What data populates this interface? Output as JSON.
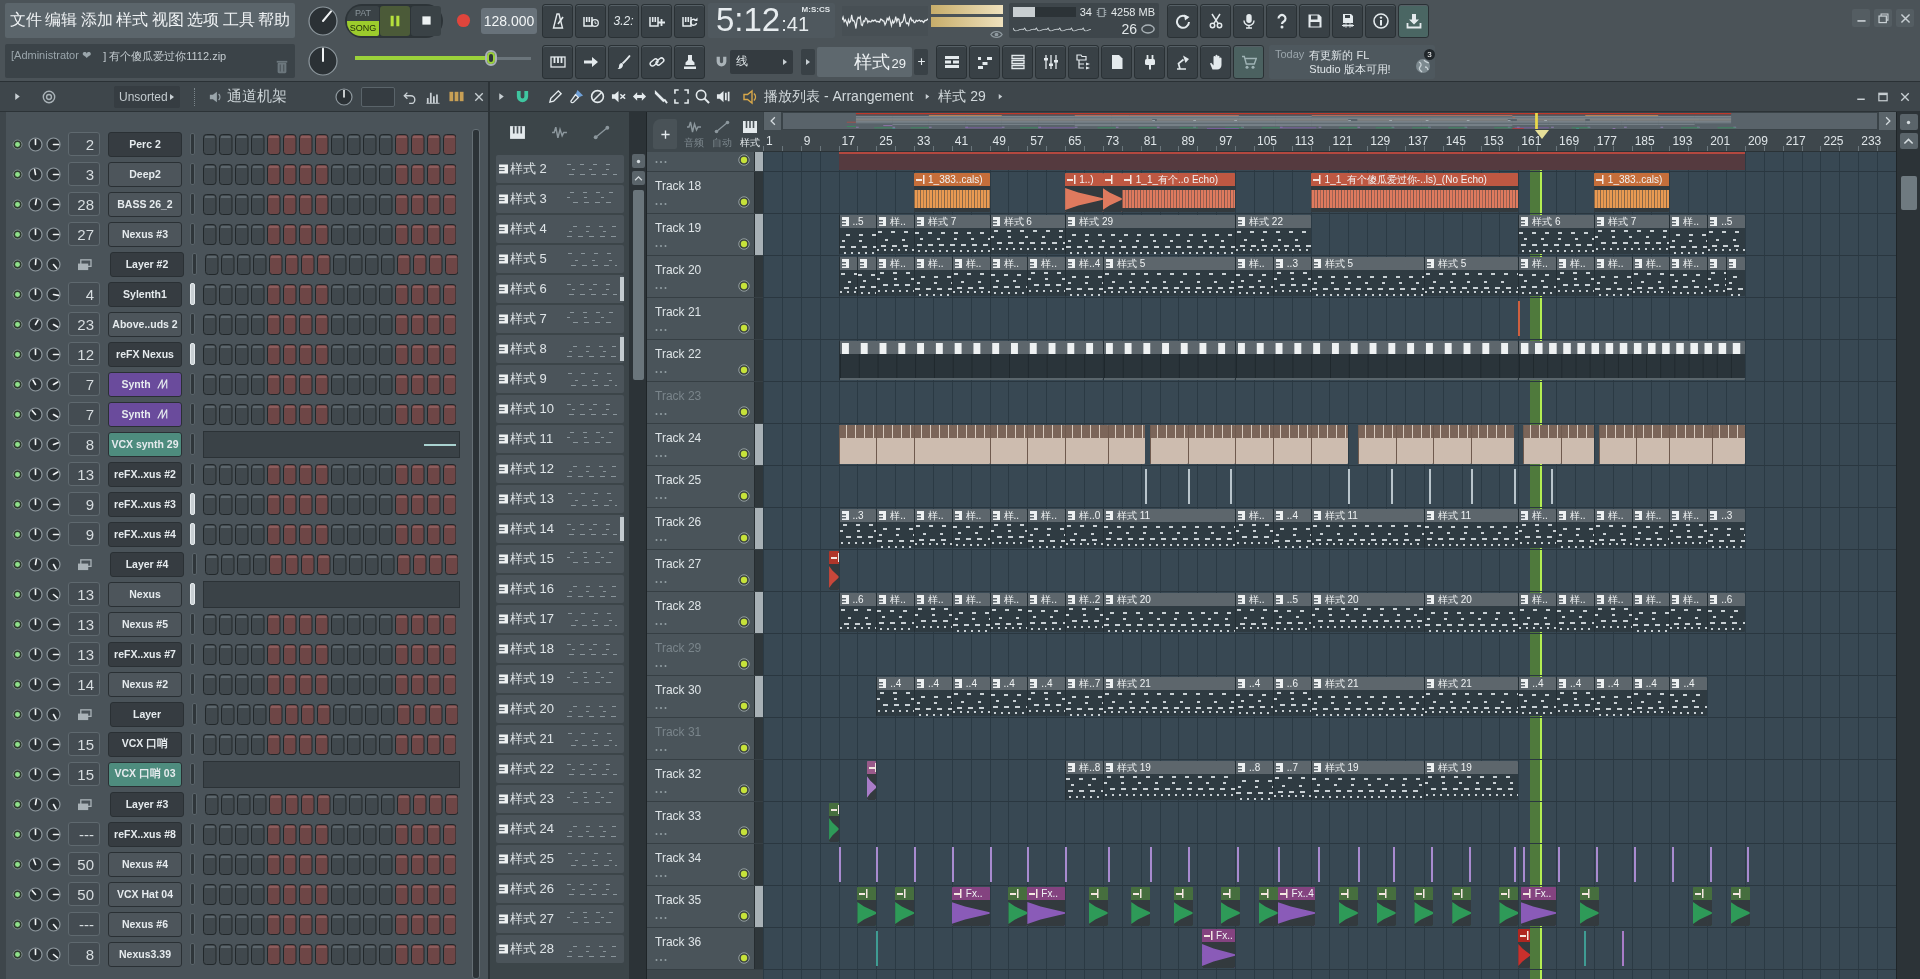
{
  "toolbar": {
    "menu": [
      "文件",
      "编辑",
      "添加",
      "样式",
      "视图",
      "选项",
      "工具",
      "帮助"
    ],
    "hint": {
      "user": "[Administrator ❤",
      "message": "] 有个傻瓜爱过你1112.zip"
    },
    "transport": {
      "modes": [
        {
          "label": "PAT",
          "selected": false
        },
        {
          "label": "SONG",
          "selected": true
        }
      ],
      "playing": true,
      "recording": false,
      "tempo": "128.000"
    },
    "pitch": {
      "level": 0.77
    },
    "countdown": "3.2:",
    "clock": {
      "time": "5:12",
      "centiseconds": ":41",
      "format": "M:S:CS"
    },
    "cpu": {
      "load": "34",
      "level": 0.35,
      "memory": "4258 MB",
      "polyphony": "26"
    },
    "snap": "线",
    "pattern": {
      "name": "样式",
      "number": "29"
    },
    "news": {
      "day": "Today",
      "message": "有更新的 FL Studio 版本可用!",
      "badge": "3"
    }
  },
  "channel_rack": {
    "filter": "Unsorted",
    "title": "通道机架",
    "channels": [
      {
        "name": "Perc 2",
        "track": "2",
        "kind": "instrument",
        "color": "#363c41",
        "selected": false
      },
      {
        "name": "Deep2",
        "track": "3",
        "kind": "instrument",
        "color": "#4d555b",
        "selected": false
      },
      {
        "name": "BASS 26_2",
        "track": "28",
        "kind": "instrument",
        "color": "#4d555b",
        "selected": false
      },
      {
        "name": "Nexus #3",
        "track": "27",
        "kind": "instrument",
        "color": "#4d555b",
        "selected": false
      },
      {
        "name": "Layer #2",
        "kind": "layer",
        "color": "#363c41",
        "selected": false
      },
      {
        "name": "Sylenth1",
        "track": "4",
        "kind": "instrument",
        "color": "#363c41",
        "selected": true
      },
      {
        "name": "Above..uds 2",
        "track": "23",
        "kind": "instrument",
        "color": "#4d555b",
        "selected": false
      },
      {
        "name": "reFX Nexus",
        "track": "12",
        "kind": "instrument",
        "color": "#363c41",
        "selected": true
      },
      {
        "name": "Synth",
        "track": "7",
        "kind": "synth",
        "color": "#6a4b9c",
        "selected": false
      },
      {
        "name": "Synth",
        "track": "7",
        "kind": "synth",
        "color": "#6a4b9c",
        "selected": false
      },
      {
        "name": "VCX synth 29",
        "track": "8",
        "kind": "notes",
        "color": "#4e8c7e",
        "selected": false
      },
      {
        "name": "reFX..xus #2",
        "track": "13",
        "kind": "instrument",
        "color": "#363c41",
        "selected": false
      },
      {
        "name": "reFX..xus #3",
        "track": "9",
        "kind": "instrument",
        "color": "#363c41",
        "selected": true
      },
      {
        "name": "reFX..xus #4",
        "track": "9",
        "kind": "instrument",
        "color": "#363c41",
        "selected": true
      },
      {
        "name": "Layer #4",
        "kind": "layer",
        "color": "#363c41",
        "selected": false
      },
      {
        "name": "Nexus",
        "track": "13",
        "kind": "blank",
        "color": "#4d555b",
        "selected": true
      },
      {
        "name": "Nexus #5",
        "track": "13",
        "kind": "instrument",
        "color": "#4d555b",
        "selected": false
      },
      {
        "name": "reFX..xus #7",
        "track": "13",
        "kind": "instrument",
        "color": "#363c41",
        "selected": false
      },
      {
        "name": "Nexus #2",
        "track": "14",
        "kind": "instrument",
        "color": "#4d555b",
        "selected": false
      },
      {
        "name": "Layer",
        "kind": "layer",
        "color": "#363c41",
        "selected": false
      },
      {
        "name": "VCX 口哨",
        "track": "15",
        "kind": "instrument",
        "color": "#363c41",
        "selected": false
      },
      {
        "name": "VCX 口哨 03",
        "track": "15",
        "kind": "blank",
        "color": "#4e8c7e",
        "selected": false
      },
      {
        "name": "Layer #3",
        "kind": "layer",
        "color": "#363c41",
        "selected": false
      },
      {
        "name": "reFX..xus #8",
        "track": "---",
        "kind": "instrument",
        "color": "#363c41",
        "selected": false
      },
      {
        "name": "Nexus #4",
        "track": "50",
        "kind": "instrument",
        "color": "#4d555b",
        "selected": false
      },
      {
        "name": "VCX Hat 04",
        "track": "50",
        "kind": "instrument",
        "color": "#4d555b",
        "selected": false
      },
      {
        "name": "Nexus #6",
        "track": "---",
        "kind": "instrument",
        "color": "#4d555b",
        "selected": false
      },
      {
        "name": "Nexus3.39",
        "track": "8",
        "kind": "instrument",
        "color": "#4d555b",
        "selected": false
      }
    ]
  },
  "playlist": {
    "title": "播放列表 - Arrangement",
    "pattern": "样式 29",
    "view_tabs": [
      {
        "label": "音频",
        "selected": false
      },
      {
        "label": "自动",
        "selected": false
      },
      {
        "label": "样式",
        "selected": true
      }
    ],
    "patterns": [
      {
        "name": "样式 2",
        "selected": false
      },
      {
        "name": "样式 3",
        "selected": false
      },
      {
        "name": "样式 4",
        "selected": false
      },
      {
        "name": "样式 5",
        "selected": false
      },
      {
        "name": "样式 6",
        "selected": true
      },
      {
        "name": "样式 7",
        "selected": false
      },
      {
        "name": "样式 8",
        "selected": true
      },
      {
        "name": "样式 9",
        "selected": false
      },
      {
        "name": "样式 10",
        "selected": false
      },
      {
        "name": "样式 11",
        "selected": false
      },
      {
        "name": "样式 12",
        "selected": false
      },
      {
        "name": "样式 13",
        "selected": false
      },
      {
        "name": "样式 14",
        "selected": true
      },
      {
        "name": "样式 15",
        "selected": false
      },
      {
        "name": "样式 16",
        "selected": false
      },
      {
        "name": "样式 17",
        "selected": false
      },
      {
        "name": "样式 18",
        "selected": false
      },
      {
        "name": "样式 19",
        "selected": false
      },
      {
        "name": "样式 20",
        "selected": false
      },
      {
        "name": "样式 21",
        "selected": false
      },
      {
        "name": "样式 22",
        "selected": false
      },
      {
        "name": "样式 23",
        "selected": false
      },
      {
        "name": "样式 24",
        "selected": false
      },
      {
        "name": "样式 25",
        "selected": false
      },
      {
        "name": "样式 26",
        "selected": false
      },
      {
        "name": "样式 27",
        "selected": false
      },
      {
        "name": "样式 28",
        "selected": false
      }
    ],
    "ruler": [
      "1",
      "9",
      "17",
      "25",
      "33",
      "41",
      "49",
      "57",
      "65",
      "73",
      "81",
      "89",
      "97",
      "105",
      "113",
      "121",
      "129",
      "137",
      "145",
      "153",
      "161",
      "169",
      "177",
      "185",
      "193",
      "201",
      "209",
      "217",
      "225",
      "233"
    ],
    "tracks": [
      {
        "partial": true,
        "selected": true,
        "clips": [
          {
            "kind": "band",
            "color": "#553a3f"
          }
        ]
      },
      {
        "name": "Track 18",
        "partial": false,
        "enabled": true,
        "selected": false,
        "clips": [
          {
            "kind": "audio",
            "color": "#e99a52",
            "label": "1_383..cals)"
          },
          {
            "kind": "audio",
            "color": "#df7a5e",
            "label": "1..)"
          },
          {
            "kind": "audio",
            "color": "#df7a5e"
          },
          {
            "kind": "audio",
            "color": "#df7a5e",
            "label": "1_1_有个..o Echo)"
          },
          {
            "kind": "audio",
            "color": "#df7a5e",
            "label": "1_1_有个傻瓜爱过你-..ls)_(No Echo)"
          },
          {
            "kind": "audio",
            "color": "#e99a52",
            "label": "1_383..cals)"
          }
        ]
      },
      {
        "name": "Track 19",
        "partial": false,
        "enabled": true,
        "selected": true,
        "clips": [
          {
            "kind": "pattern",
            "label": "..5"
          },
          {
            "kind": "pattern",
            "label": "样.."
          },
          {
            "kind": "pattern",
            "label": "样式 7"
          },
          {
            "kind": "pattern",
            "label": "样式 6"
          },
          {
            "kind": "pattern",
            "label": "样式 29"
          },
          {
            "kind": "pattern",
            "label": "样式 22"
          },
          {
            "kind": "pattern",
            "label": "样式 6"
          },
          {
            "kind": "pattern",
            "label": "样式 7"
          },
          {
            "kind": "pattern",
            "label": "样.."
          },
          {
            "kind": "pattern",
            "label": "..5"
          }
        ]
      },
      {
        "name": "Track 20",
        "partial": false,
        "enabled": true,
        "selected": false,
        "clips": [
          {
            "kind": "pattern"
          },
          {
            "kind": "pattern"
          },
          {
            "kind": "pattern",
            "label": "样.."
          },
          {
            "kind": "pattern",
            "label": "样.."
          },
          {
            "kind": "pattern",
            "label": "样.."
          },
          {
            "kind": "pattern",
            "label": "样.."
          },
          {
            "kind": "pattern",
            "label": "样.."
          },
          {
            "kind": "pattern",
            "label": "样..4"
          },
          {
            "kind": "pattern",
            "label": "样式 5"
          },
          {
            "kind": "pattern",
            "label": "样.."
          },
          {
            "kind": "pattern",
            "label": "..3"
          },
          {
            "kind": "pattern",
            "label": "样式 5"
          },
          {
            "kind": "pattern",
            "label": "样式 5"
          },
          {
            "kind": "pattern",
            "label": "样.."
          },
          {
            "kind": "pattern",
            "label": "样.."
          },
          {
            "kind": "pattern",
            "label": "样.."
          },
          {
            "kind": "pattern",
            "label": "样.."
          },
          {
            "kind": "pattern",
            "label": "样.."
          },
          {
            "kind": "pattern"
          },
          {
            "kind": "pattern"
          }
        ]
      },
      {
        "name": "Track 21",
        "partial": false,
        "enabled": true,
        "selected": false,
        "clips": [
          {
            "kind": "sliver",
            "color": "#d0603f"
          }
        ]
      },
      {
        "name": "Track 22",
        "partial": false,
        "enabled": true,
        "selected": false,
        "clips": [
          {
            "kind": "run"
          },
          {
            "kind": "run"
          },
          {
            "kind": "run"
          },
          {
            "kind": "run"
          }
        ]
      },
      {
        "name": "Track 23",
        "partial": false,
        "enabled": false,
        "selected": false
      },
      {
        "name": "Track 24",
        "partial": false,
        "enabled": true,
        "selected": true,
        "clips": [
          {
            "kind": "slices",
            "color": "#cdbcaf"
          },
          {
            "kind": "slices",
            "color": "#cdbcaf"
          },
          {
            "kind": "slices",
            "color": "#cdbcaf"
          },
          {
            "kind": "slices",
            "color": "#cdbcaf"
          },
          {
            "kind": "slices",
            "color": "#cdbcaf"
          },
          {
            "kind": "slices",
            "color": "#cdbcaf"
          },
          {
            "kind": "slices",
            "color": "#cdbcaf"
          },
          {
            "kind": "slices",
            "color": "#cdbcaf"
          },
          {
            "kind": "slices",
            "color": "#cdbcaf"
          },
          {
            "kind": "slices",
            "color": "#cdbcaf"
          },
          {
            "kind": "slices",
            "color": "#cdbcaf"
          },
          {
            "kind": "slices",
            "color": "#cdbcaf"
          },
          {
            "kind": "slices",
            "color": "#cdbcaf"
          },
          {
            "kind": "slices",
            "color": "#cdbcaf"
          },
          {
            "kind": "slices",
            "color": "#cdbcaf"
          },
          {
            "kind": "slices",
            "color": "#cdbcaf"
          },
          {
            "kind": "slices",
            "color": "#cdbcaf"
          },
          {
            "kind": "slices",
            "color": "#cdbcaf"
          },
          {
            "kind": "slices",
            "color": "#cdbcaf"
          },
          {
            "kind": "slices",
            "color": "#cdbcaf"
          },
          {
            "kind": "slices",
            "color": "#cdbcaf"
          },
          {
            "kind": "slices",
            "color": "#cdbcaf"
          }
        ]
      },
      {
        "name": "Track 25",
        "partial": false,
        "enabled": true,
        "selected": false,
        "clips": [
          {
            "kind": "sliver",
            "color": "#b9c5cc"
          },
          {
            "kind": "sliver",
            "color": "#b9c5cc"
          },
          {
            "kind": "sliver",
            "color": "#b9c5cc"
          },
          {
            "kind": "sliver",
            "color": "#b9c5cc"
          },
          {
            "kind": "sliver",
            "color": "#b9c5cc"
          },
          {
            "kind": "sliver",
            "color": "#b9c5cc"
          },
          {
            "kind": "sliver",
            "color": "#b9c5cc"
          },
          {
            "kind": "sliver",
            "color": "#b9c5cc"
          },
          {
            "kind": "sliver",
            "color": "#b9c5cc"
          }
        ]
      },
      {
        "name": "Track 26",
        "partial": false,
        "enabled": true,
        "selected": true,
        "clips": [
          {
            "kind": "pattern",
            "label": "..3"
          },
          {
            "kind": "pattern",
            "label": "样.."
          },
          {
            "kind": "pattern",
            "label": "样.."
          },
          {
            "kind": "pattern",
            "label": "样.."
          },
          {
            "kind": "pattern",
            "label": "样.."
          },
          {
            "kind": "pattern",
            "label": "样.."
          },
          {
            "kind": "pattern",
            "label": "样..0"
          },
          {
            "kind": "pattern",
            "label": "样式 11"
          },
          {
            "kind": "pattern",
            "label": "样.."
          },
          {
            "kind": "pattern",
            "label": "..4"
          },
          {
            "kind": "pattern",
            "label": "样式 11"
          },
          {
            "kind": "pattern",
            "label": "样式 11"
          },
          {
            "kind": "pattern",
            "label": "样.."
          },
          {
            "kind": "pattern",
            "label": "样.."
          },
          {
            "kind": "pattern",
            "label": "样.."
          },
          {
            "kind": "pattern",
            "label": "样.."
          },
          {
            "kind": "pattern",
            "label": "样.."
          },
          {
            "kind": "pattern",
            "label": "..3"
          }
        ]
      },
      {
        "name": "Track 27",
        "partial": false,
        "enabled": true,
        "selected": false,
        "clips": [
          {
            "kind": "audio",
            "color": "#c9473a"
          }
        ]
      },
      {
        "name": "Track 28",
        "partial": false,
        "enabled": true,
        "selected": true,
        "clips": [
          {
            "kind": "pattern",
            "label": "..6"
          },
          {
            "kind": "pattern",
            "label": "样.."
          },
          {
            "kind": "pattern",
            "label": "样.."
          },
          {
            "kind": "pattern",
            "label": "样.."
          },
          {
            "kind": "pattern",
            "label": "样.."
          },
          {
            "kind": "pattern",
            "label": "样.."
          },
          {
            "kind": "pattern",
            "label": "样..2"
          },
          {
            "kind": "pattern",
            "label": "样式 20"
          },
          {
            "kind": "pattern",
            "label": "样.."
          },
          {
            "kind": "pattern",
            "label": "..5"
          },
          {
            "kind": "pattern",
            "label": "样式 20"
          },
          {
            "kind": "pattern",
            "label": "样式 20"
          },
          {
            "kind": "pattern",
            "label": "样.."
          },
          {
            "kind": "pattern",
            "label": "样.."
          },
          {
            "kind": "pattern",
            "label": "样.."
          },
          {
            "kind": "pattern",
            "label": "样.."
          },
          {
            "kind": "pattern",
            "label": "样.."
          },
          {
            "kind": "pattern",
            "label": "..6"
          }
        ]
      },
      {
        "name": "Track 29",
        "partial": false,
        "enabled": false,
        "selected": false
      },
      {
        "name": "Track 30",
        "partial": false,
        "enabled": true,
        "selected": true,
        "clips": [
          {
            "kind": "pattern",
            "label": "..4"
          },
          {
            "kind": "pattern",
            "label": "..4"
          },
          {
            "kind": "pattern",
            "label": "..4"
          },
          {
            "kind": "pattern",
            "label": "..4"
          },
          {
            "kind": "pattern",
            "label": "..4"
          },
          {
            "kind": "pattern",
            "label": "样..7"
          },
          {
            "kind": "pattern",
            "label": "样式 21"
          },
          {
            "kind": "pattern",
            "label": "..4"
          },
          {
            "kind": "pattern",
            "label": "..6"
          },
          {
            "kind": "pattern",
            "label": "样式 21"
          },
          {
            "kind": "pattern",
            "label": "样式 21"
          },
          {
            "kind": "pattern",
            "label": "..4"
          },
          {
            "kind": "pattern",
            "label": "..4"
          },
          {
            "kind": "pattern",
            "label": "..4"
          },
          {
            "kind": "pattern",
            "label": "..4"
          },
          {
            "kind": "pattern",
            "label": "..4"
          }
        ]
      },
      {
        "name": "Track 31",
        "partial": false,
        "enabled": false,
        "selected": false
      },
      {
        "name": "Track 32",
        "partial": false,
        "enabled": true,
        "selected": false,
        "clips": [
          {
            "kind": "audio",
            "color": "#a97cc8"
          },
          {
            "kind": "pattern",
            "label": "样..8"
          },
          {
            "kind": "pattern",
            "label": "样式 19"
          },
          {
            "kind": "pattern",
            "label": "..8"
          },
          {
            "kind": "pattern",
            "label": "..7"
          },
          {
            "kind": "pattern",
            "label": "样式 19"
          },
          {
            "kind": "pattern",
            "label": "样式 19"
          }
        ]
      },
      {
        "name": "Track 33",
        "partial": false,
        "enabled": true,
        "selected": false,
        "clips": [
          {
            "kind": "audio",
            "color": "#2e9a58"
          }
        ]
      },
      {
        "name": "Track 34",
        "partial": false,
        "enabled": true,
        "selected": false,
        "clips": [
          {
            "kind": "sliver",
            "color": "#a98bd0"
          },
          {
            "kind": "sliver",
            "color": "#a98bd0"
          },
          {
            "kind": "sliver",
            "color": "#a98bd0"
          },
          {
            "kind": "sliver",
            "color": "#a98bd0"
          },
          {
            "kind": "sliver",
            "color": "#a98bd0"
          },
          {
            "kind": "sliver",
            "color": "#a98bd0"
          },
          {
            "kind": "sliver",
            "color": "#a98bd0"
          },
          {
            "kind": "sliver",
            "color": "#a98bd0"
          },
          {
            "kind": "sliver",
            "color": "#a98bd0"
          },
          {
            "kind": "sliver",
            "color": "#a98bd0"
          },
          {
            "kind": "sliver",
            "color": "#a98bd0"
          },
          {
            "kind": "sliver",
            "color": "#a98bd0"
          },
          {
            "kind": "sliver",
            "color": "#a98bd0"
          },
          {
            "kind": "sliver",
            "color": "#a98bd0"
          },
          {
            "kind": "sliver",
            "color": "#a98bd0"
          },
          {
            "kind": "sliver",
            "color": "#a98bd0"
          },
          {
            "kind": "sliver",
            "color": "#a98bd0"
          },
          {
            "kind": "sliver",
            "color": "#a98bd0"
          },
          {
            "kind": "sliver",
            "color": "#a98bd0"
          },
          {
            "kind": "sliver",
            "color": "#a98bd0"
          },
          {
            "kind": "sliver",
            "color": "#a98bd0"
          },
          {
            "kind": "sliver",
            "color": "#a98bd0"
          },
          {
            "kind": "sliver",
            "color": "#a98bd0"
          },
          {
            "kind": "sliver",
            "color": "#a98bd0"
          },
          {
            "kind": "sliver",
            "color": "#a98bd0"
          }
        ]
      },
      {
        "name": "Track 35",
        "partial": false,
        "enabled": true,
        "selected": true,
        "clips": [
          {
            "kind": "audio",
            "color": "#2e9a58"
          },
          {
            "kind": "audio",
            "color": "#2e9a58"
          },
          {
            "kind": "audio",
            "color": "#8a5bb8",
            "label": "Fx.."
          },
          {
            "kind": "audio",
            "color": "#2e9a58"
          },
          {
            "kind": "audio",
            "color": "#8a5bb8",
            "label": "Fx.."
          },
          {
            "kind": "audio",
            "color": "#2e9a58"
          },
          {
            "kind": "audio",
            "color": "#2e9a58"
          },
          {
            "kind": "audio",
            "color": "#2e9a58"
          },
          {
            "kind": "audio",
            "color": "#2e9a58"
          },
          {
            "kind": "audio",
            "color": "#2e9a58"
          },
          {
            "kind": "audio",
            "color": "#8a5bb8",
            "label": "Fx..4"
          },
          {
            "kind": "audio",
            "color": "#2e9a58"
          },
          {
            "kind": "audio",
            "color": "#2e9a58"
          },
          {
            "kind": "audio",
            "color": "#2e9a58"
          },
          {
            "kind": "audio",
            "color": "#2e9a58"
          },
          {
            "kind": "audio",
            "color": "#2e9a58"
          },
          {
            "kind": "audio",
            "color": "#8a5bb8",
            "label": "Fx.."
          },
          {
            "kind": "audio",
            "color": "#2e9a58"
          },
          {
            "kind": "audio",
            "color": "#2e9a58"
          },
          {
            "kind": "audio",
            "color": "#2e9a58"
          }
        ]
      },
      {
        "name": "Track 36",
        "partial": false,
        "enabled": true,
        "selected": false,
        "clips": [
          {
            "kind": "sliver",
            "color": "#3f9c93"
          },
          {
            "kind": "audio",
            "color": "#8a5bb8",
            "label": "Fx.."
          },
          {
            "kind": "audio",
            "color": "#c9302c"
          },
          {
            "kind": "sliver",
            "color": "#3f9c93"
          },
          {
            "kind": "sliver",
            "color": "#a97cc8"
          }
        ]
      }
    ]
  }
}
